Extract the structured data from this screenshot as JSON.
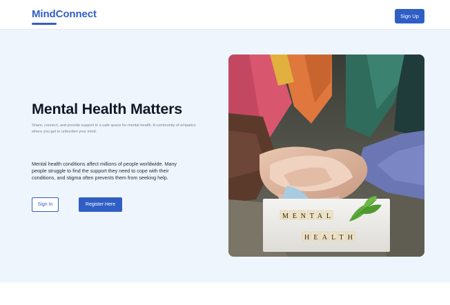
{
  "header": {
    "logo": "MindConnect",
    "signup_label": "Sign Up"
  },
  "hero": {
    "title": "Mental Health Matters",
    "subtitle": "Share, connect, and provide support in a safe space for mental health. A community of empatics where you get to unburden your mind.",
    "paragraph": "Mental health conditions affect millions of people worldwide. Many people struggle to find the support they need to cope with their conditions, and stigma often prevents them from seeking help.",
    "signin_label": "Sign In",
    "register_label": "Register Here",
    "image": {
      "tile_word_1": "MENTAL",
      "tile_word_2": "HEALTH"
    }
  },
  "colors": {
    "brand": "#2f5fc4",
    "hero_bg": "#eef5fd",
    "title_text": "#111827"
  }
}
